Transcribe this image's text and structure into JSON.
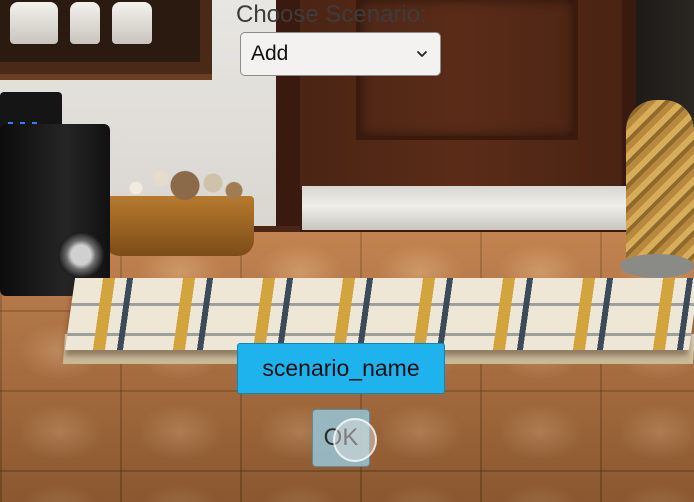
{
  "scenario_picker": {
    "label": "Choose Scenario:",
    "selected": "Add"
  },
  "scenario_name_button": {
    "label": "scenario_name"
  },
  "ok_button": {
    "label": "OK"
  },
  "colors": {
    "name_button_bg": "#1fb3ee",
    "ok_button_bg": "#96c4d6",
    "select_bg": "#f3f2f0"
  },
  "icons": {
    "select_arrow": "chevron-down-icon"
  }
}
